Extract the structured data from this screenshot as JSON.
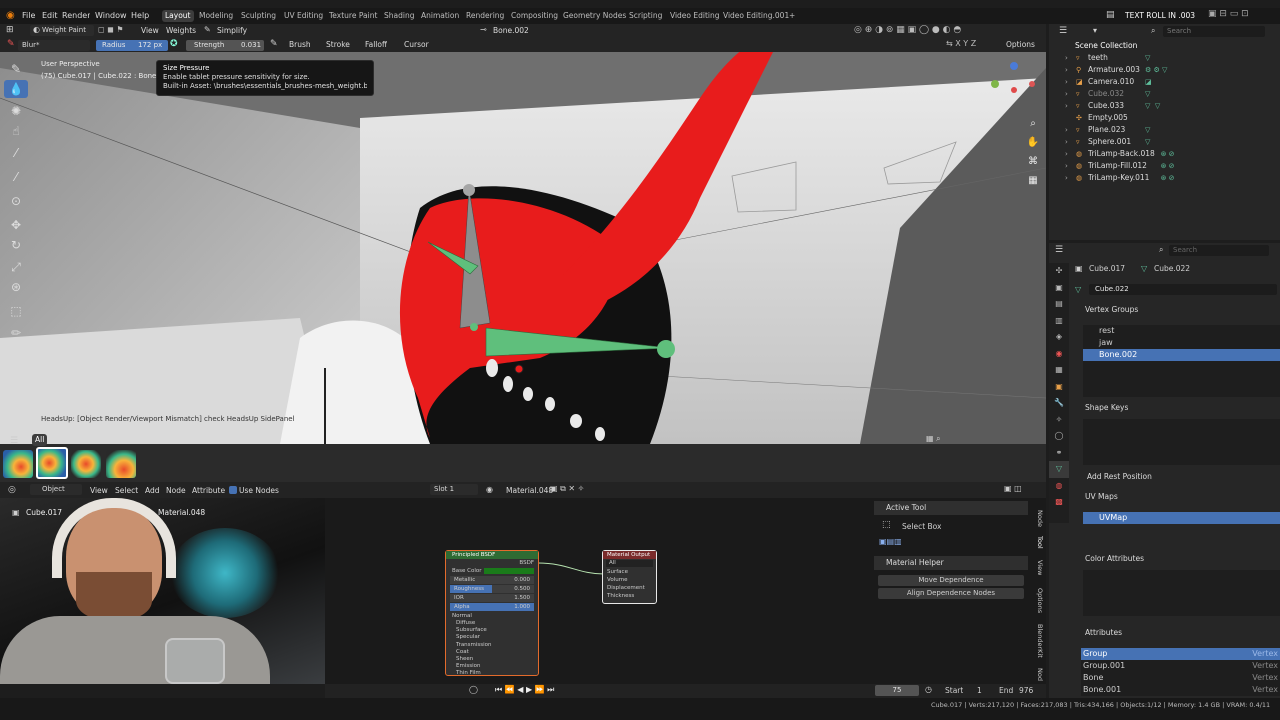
{
  "title_bar": {
    "file_title": "TEXT ROLL IN .003"
  },
  "menus": [
    "File",
    "Edit",
    "Render",
    "Window",
    "Help"
  ],
  "workspaces": [
    "Layout",
    "Modeling",
    "Sculpting",
    "UV Editing",
    "Texture Paint",
    "Shading",
    "Animation",
    "Rendering",
    "Compositing",
    "Geometry Nodes",
    "Scripting",
    "Video Editing",
    "Video Editing.001",
    "+"
  ],
  "header": {
    "mode": "Weight Paint",
    "view": "View",
    "weights": "Weights",
    "simplify": "Simplify",
    "bone": "Bone.002"
  },
  "tool_settings": {
    "brush_name": "Blur*",
    "radius_label": "Radius",
    "radius_value": "172 px",
    "strength_label": "Strength",
    "strength_value": "0.031",
    "brush": "Brush",
    "stroke": "Stroke",
    "falloff": "Falloff",
    "cursor": "Cursor",
    "options": "Options"
  },
  "viewport": {
    "perspective": "User Perspective",
    "object_info": "(75) Cube.017 | Cube.022 : Bone.002",
    "headsup": "HeadsUp: [Object Render/Viewport Mismatch] check HeadsUp SidePanel"
  },
  "tooltip": {
    "title": "Size Pressure",
    "line1": "Enable tablet pressure sensitivity for size.",
    "line2": "Built-in Asset: \\brushes\\essentials_brushes-mesh_weight.blend"
  },
  "brush_bar": {
    "filter": "All"
  },
  "node_header": {
    "object": "Object",
    "view": "View",
    "select": "Select",
    "add": "Add",
    "node": "Node",
    "attribute": "Attribute",
    "use_nodes": "Use Nodes",
    "slot": "Slot 1",
    "material": "Material.048"
  },
  "node_editor": {
    "crumb_object": "Cube.017",
    "crumb_material": "Material.048",
    "principled": {
      "title": "Principled BSDF",
      "out": "BSDF",
      "base_color": "Base Color",
      "metallic": "Metallic",
      "metallic_v": "0.000",
      "roughness": "Roughness",
      "roughness_v": "0.500",
      "ior": "IOR",
      "ior_v": "1.500",
      "alpha": "Alpha",
      "alpha_v": "1.000",
      "normal": "Normal",
      "sub": [
        "Diffuse",
        "Subsurface",
        "Specular",
        "Transmission",
        "Coat",
        "Sheen",
        "Emission",
        "Thin Film"
      ]
    },
    "output": {
      "title": "Material Output",
      "target": "All",
      "surface": "Surface",
      "volume": "Volume",
      "displacement": "Displacement",
      "thickness": "Thickness"
    }
  },
  "side_panel": {
    "active_tool": "Active Tool",
    "select_box": "Select Box",
    "material_helper": "Material Helper",
    "move_dependence": "Move Dependence",
    "align_dependence": "Align Dependence Nodes",
    "tabs": [
      "Node",
      "Tool",
      "View",
      "Options",
      "BlenderKit",
      "Nod"
    ]
  },
  "timeline": {
    "frame": "75",
    "start_label": "Start",
    "start": "1",
    "end_label": "End",
    "end": "976"
  },
  "status": {
    "text": "Cube.017 | Verts:217,120 | Faces:217,083 | Tris:434,166 | Objects:1/12 | Memory: 1.4 GB | VRAM: 0.4/11"
  },
  "outliner": {
    "search": "Search",
    "root": "Scene Collection",
    "items": [
      "teeth",
      "Armature.003",
      "Camera.010",
      "Cube.032",
      "Cube.033",
      "Empty.005",
      "Plane.023",
      "Sphere.001",
      "TriLamp-Back.018",
      "TriLamp-Fill.012",
      "TriLamp-Key.011"
    ]
  },
  "properties": {
    "search": "Search",
    "crumb_obj": "Cube.017",
    "crumb_mesh": "Cube.022",
    "mesh_name": "Cube.022",
    "vertex_groups": "Vertex Groups",
    "groups": [
      "rest",
      "jaw",
      "Bone.002"
    ],
    "shape_keys": "Shape Keys",
    "add_rest": "Add Rest Position",
    "uv_maps": "UV Maps",
    "uv_map": "UVMap",
    "color_attributes": "Color Attributes",
    "attributes": "Attributes",
    "attrs": [
      "Group",
      "Group.001",
      "Bone",
      "Bone.001"
    ],
    "attr_domain": "Vertex"
  },
  "colors": {
    "accent": "#4672b4",
    "red_paint": "#e81c1c",
    "bone_green": "#5fbf7c"
  }
}
